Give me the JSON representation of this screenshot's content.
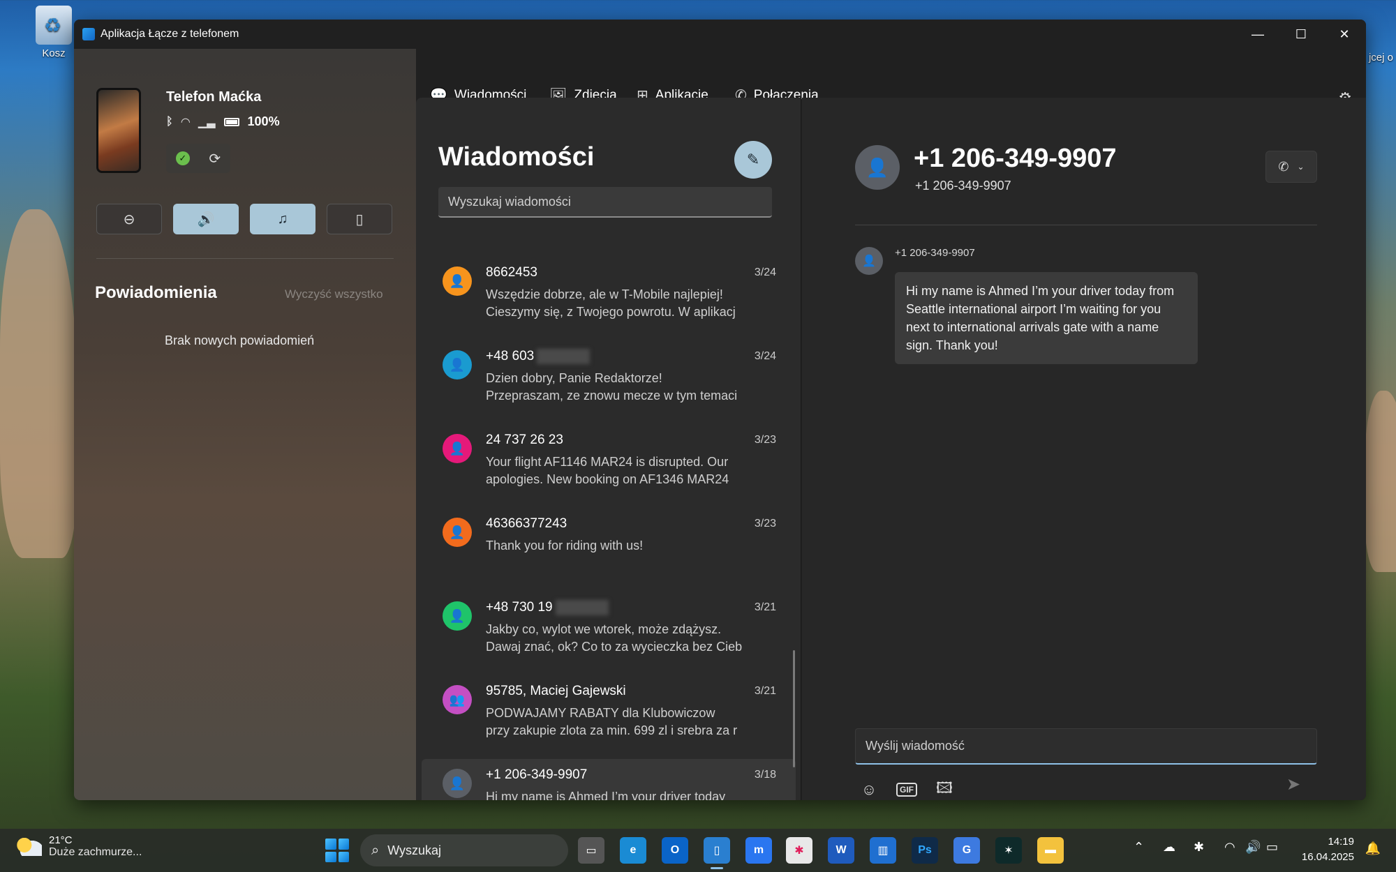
{
  "desktop": {
    "recycle_bin_label": "Kosz",
    "edge_text": "jcej o"
  },
  "window": {
    "title": "Aplikacja Łącze z telefonem",
    "controls": {
      "minimize": "—",
      "maximize": "☐",
      "close": "✕"
    }
  },
  "phone": {
    "name": "Telefon Maćka",
    "battery": "100%",
    "quick_actions": [
      {
        "icon": "do-not-disturb-icon",
        "glyph": "⊖",
        "active": false
      },
      {
        "icon": "volume-icon",
        "glyph": "🔊",
        "active": true
      },
      {
        "icon": "music-icon",
        "glyph": "♫",
        "active": true
      },
      {
        "icon": "phone-screen-icon",
        "glyph": "▯",
        "active": false
      }
    ]
  },
  "notifications": {
    "title": "Powiadomienia",
    "clear_label": "Wyczyść wszystko",
    "empty_label": "Brak nowych powiadomień"
  },
  "tabs": [
    {
      "label": "Wiadomości",
      "icon": "chat-icon",
      "glyph": "💬"
    },
    {
      "label": "Zdjęcia",
      "icon": "photos-icon",
      "glyph": "🖼"
    },
    {
      "label": "Aplikacje",
      "icon": "apps-icon",
      "glyph": "⊞"
    },
    {
      "label": "Połączenia",
      "icon": "phone-icon",
      "glyph": "✆"
    }
  ],
  "toolbar": {
    "more": "···",
    "settings": "⚙"
  },
  "messages": {
    "title": "Wiadomości",
    "search_placeholder": "Wyszukaj wiadomości",
    "threads": [
      {
        "name": "8662453",
        "date": "3/24",
        "line1": "Wszędzie dobrze, ale w T-Mobile najlepiej!",
        "line2": "Cieszymy się, z Twojego powrotu. W aplikacj",
        "color": "#f7941d",
        "avatar": "person",
        "blurred": false
      },
      {
        "name": "+48 603",
        "date": "3/24",
        "line1": "Dzien dobry, Panie Redaktorze!",
        "line2": "Przepraszam, ze znowu mecze w tym temaci",
        "color": "#1a9bd0",
        "avatar": "person",
        "blurred": true
      },
      {
        "name": "24 737 26 23",
        "date": "3/23",
        "line1": "Your flight AF1146 MAR24 is disrupted. Our",
        "line2": "apologies.  New booking on AF1346 MAR24",
        "color": "#e5197a",
        "avatar": "person",
        "blurred": false
      },
      {
        "name": "46366377243",
        "date": "3/23",
        "line1": "Thank you for riding with us!",
        "line2": "",
        "color": "#f26b1d",
        "avatar": "person",
        "blurred": false
      },
      {
        "name": "+48 730 19",
        "date": "3/21",
        "line1": "Jakby co, wylot we wtorek, może zdążysz.",
        "line2": "Dawaj znać, ok? Co to za wycieczka bez Cieb",
        "color": "#1fc46a",
        "avatar": "person",
        "blurred": true
      },
      {
        "name": "95785, Maciej Gajewski",
        "date": "3/21",
        "line1": "PODWAJAMY RABATY dla Klubowiczow",
        "line2": "przy zakupie zlota za min. 699 zl i srebra za r",
        "color": "#c44fc3",
        "avatar": "group",
        "blurred": false
      },
      {
        "name": "+1 206-349-9907",
        "date": "3/18",
        "line1": "Hi my name is Ahmed I’m your driver today",
        "line2": "",
        "color": "#5b5f66",
        "avatar": "person",
        "blurred": false,
        "selected": true
      }
    ]
  },
  "conversation": {
    "title": "+1 206-349-9907",
    "subtitle": "+1 206-349-9907",
    "sender": "+1 206-349-9907",
    "message": "Hi my name is Ahmed I’m your driver today from Seattle international airport I’m waiting for you next to international arrivals gate with a name sign. Thank you!",
    "input_placeholder": "Wyślij wiadomość"
  },
  "taskbar": {
    "temp": "21°C",
    "weather": "Duże zachmurze...",
    "search_label": "Wyszukaj",
    "apps": [
      {
        "name": "task-view",
        "label": "▭",
        "color": "#555"
      },
      {
        "name": "edge",
        "label": "e",
        "color": "#1a8bd4"
      },
      {
        "name": "outlook",
        "label": "O",
        "color": "#0a64c8"
      },
      {
        "name": "phone-link",
        "label": "▯",
        "color": "#2a7fd0",
        "active": true
      },
      {
        "name": "messenger",
        "label": "m",
        "color": "#2a76f0"
      },
      {
        "name": "slack",
        "label": "✱",
        "color": "#e8e8e8"
      },
      {
        "name": "word",
        "label": "W",
        "color": "#1f5bbd"
      },
      {
        "name": "trello",
        "label": "▥",
        "color": "#1f6fd0"
      },
      {
        "name": "photoshop",
        "label": "Ps",
        "color": "#0f2a48"
      },
      {
        "name": "translate",
        "label": "G",
        "color": "#3d7ae0"
      },
      {
        "name": "app-bird",
        "label": "✶",
        "color": "#0e2a2a"
      },
      {
        "name": "explorer",
        "label": "▬",
        "color": "#f3c23d"
      }
    ],
    "time": "14:19",
    "date": "16.04.2025"
  }
}
